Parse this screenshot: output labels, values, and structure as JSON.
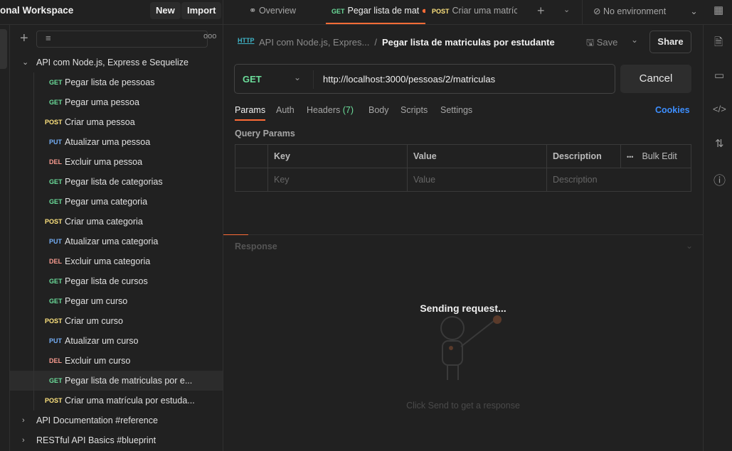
{
  "workspace": {
    "title": "onal Workspace",
    "new_label": "New",
    "import_label": "Import"
  },
  "tabs": [
    {
      "label": "Overview",
      "icon": "binoculars-icon"
    },
    {
      "method": "GET",
      "label": "Pegar lista de mat",
      "unsaved": true,
      "active": true
    },
    {
      "method": "POST",
      "label": "Criar uma matrícu"
    }
  ],
  "environment": "No environment",
  "sidebar": {
    "collections": [
      {
        "name": "API com Node.js, Express e Sequelize",
        "expanded": true
      },
      {
        "name": "API Documentation #reference"
      },
      {
        "name": "RESTful API Basics #blueprint"
      }
    ],
    "requests": [
      {
        "method": "GET",
        "name": "Pegar lista de pessoas"
      },
      {
        "method": "GET",
        "name": "Pegar uma pessoa"
      },
      {
        "method": "POST",
        "name": "Criar uma pessoa"
      },
      {
        "method": "PUT",
        "name": "Atualizar uma pessoa"
      },
      {
        "method": "DEL",
        "name": "Excluir uma pessoa"
      },
      {
        "method": "GET",
        "name": "Pegar lista de categorias"
      },
      {
        "method": "GET",
        "name": "Pegar uma categoria"
      },
      {
        "method": "POST",
        "name": "Criar uma categoria"
      },
      {
        "method": "PUT",
        "name": "Atualizar uma categoria"
      },
      {
        "method": "DEL",
        "name": "Excluir uma categoria"
      },
      {
        "method": "GET",
        "name": "Pegar lista de cursos"
      },
      {
        "method": "GET",
        "name": "Pegar um curso"
      },
      {
        "method": "POST",
        "name": "Criar um curso"
      },
      {
        "method": "PUT",
        "name": "Atualizar um curso"
      },
      {
        "method": "DEL",
        "name": "Excluir um curso"
      },
      {
        "method": "GET",
        "name": "Pegar lista de matriculas por e...",
        "selected": true
      },
      {
        "method": "POST",
        "name": "Criar uma matrícula por estuda..."
      }
    ]
  },
  "request": {
    "breadcrumb_parent": "API com Node.js, Expres...",
    "title": "Pegar lista de matriculas por estudante",
    "save_label": "Save",
    "share_label": "Share",
    "method": "GET",
    "url": "http://localhost:3000/pessoas/2/matriculas",
    "cancel_label": "Cancel",
    "tabs": [
      "Params",
      "Auth",
      "Headers",
      "Body",
      "Scripts",
      "Settings"
    ],
    "headers_count": "(7)",
    "cookies_label": "Cookies",
    "query_params_label": "Query Params",
    "columns": [
      "Key",
      "Value",
      "Description"
    ],
    "bulk_edit": "Bulk Edit",
    "placeholders": [
      "Key",
      "Value",
      "Description"
    ]
  },
  "response": {
    "label": "Response",
    "status": "Sending request...",
    "hint": "Click Send to get a response"
  },
  "colors": {
    "accent": "#ff6c37",
    "get": "#6bdd9a",
    "post": "#ffe47e",
    "put": "#74aef6",
    "del": "#f79a8e",
    "link": "#3d8fff"
  }
}
